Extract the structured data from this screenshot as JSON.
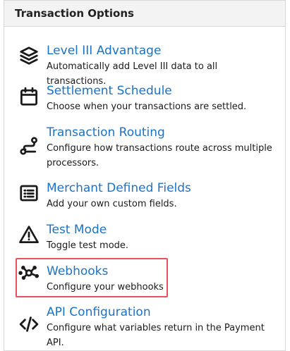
{
  "panel": {
    "title": "Transaction Options"
  },
  "items": [
    {
      "title": "Level III Advantage",
      "description": "Automatically add Level III data to all transactions.",
      "icon": "layers-icon"
    },
    {
      "title": "Settlement Schedule",
      "description": "Choose when your transactions are settled.",
      "icon": "calendar-icon"
    },
    {
      "title": "Transaction Routing",
      "description": "Configure how transactions route across multiple processors.",
      "icon": "route-icon"
    },
    {
      "title": "Merchant Defined Fields",
      "description": "Add your own custom fields.",
      "icon": "list-icon"
    },
    {
      "title": "Test Mode",
      "description": "Toggle test mode.",
      "icon": "warning-icon"
    },
    {
      "title": "Webhooks",
      "description": "Configure your webhooks",
      "icon": "webhook-icon"
    },
    {
      "title": "API Configuration",
      "description": "Configure what variables return in the Payment API.",
      "icon": "code-icon"
    }
  ],
  "colors": {
    "link": "#1a73c8",
    "highlight_border": "#e8505b",
    "header_bg": "#f3f3f3"
  }
}
